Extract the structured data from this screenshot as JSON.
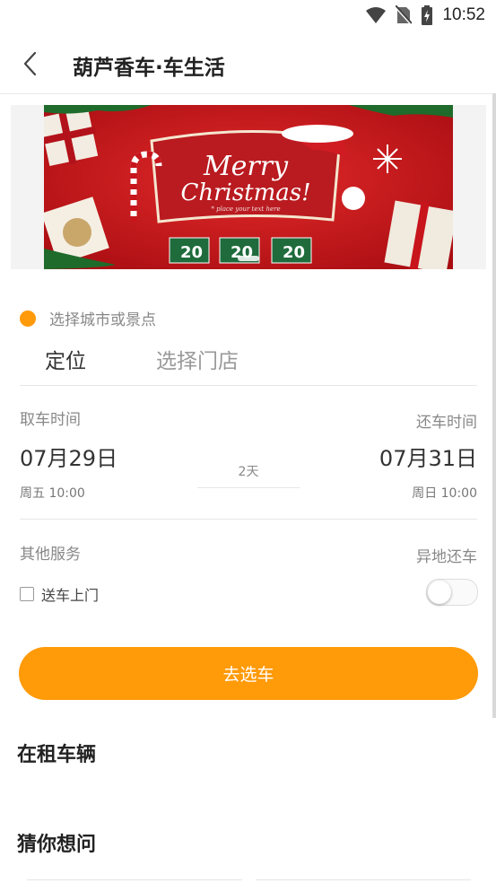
{
  "status": {
    "time": "10:52"
  },
  "appbar": {
    "title": "葫芦香车·车生活"
  },
  "banner": {
    "headline_1": "Merry",
    "headline_2": "Christmas!",
    "tagline": "* place your text here",
    "tag": "20"
  },
  "location": {
    "label": "选择城市或景点",
    "tab_locate": "定位",
    "tab_store": "选择门店"
  },
  "pickup": {
    "label": "取车时间",
    "date": "07月29日",
    "weekday_time": "周五 10:00"
  },
  "duration": "2天",
  "return": {
    "label": "还车时间",
    "date": "07月31日",
    "weekday_time": "周日 10:00"
  },
  "services": {
    "label": "其他服务",
    "delivery_label": "送车上门",
    "delivery_checked": false,
    "diff_return_label": "异地还车",
    "diff_return_on": false
  },
  "cta_label": "去选车",
  "sections": {
    "renting": "在租车辆",
    "faq": "猜你想问"
  },
  "colors": {
    "accent": "#ff9a08",
    "banner_red": "#c8141b"
  }
}
